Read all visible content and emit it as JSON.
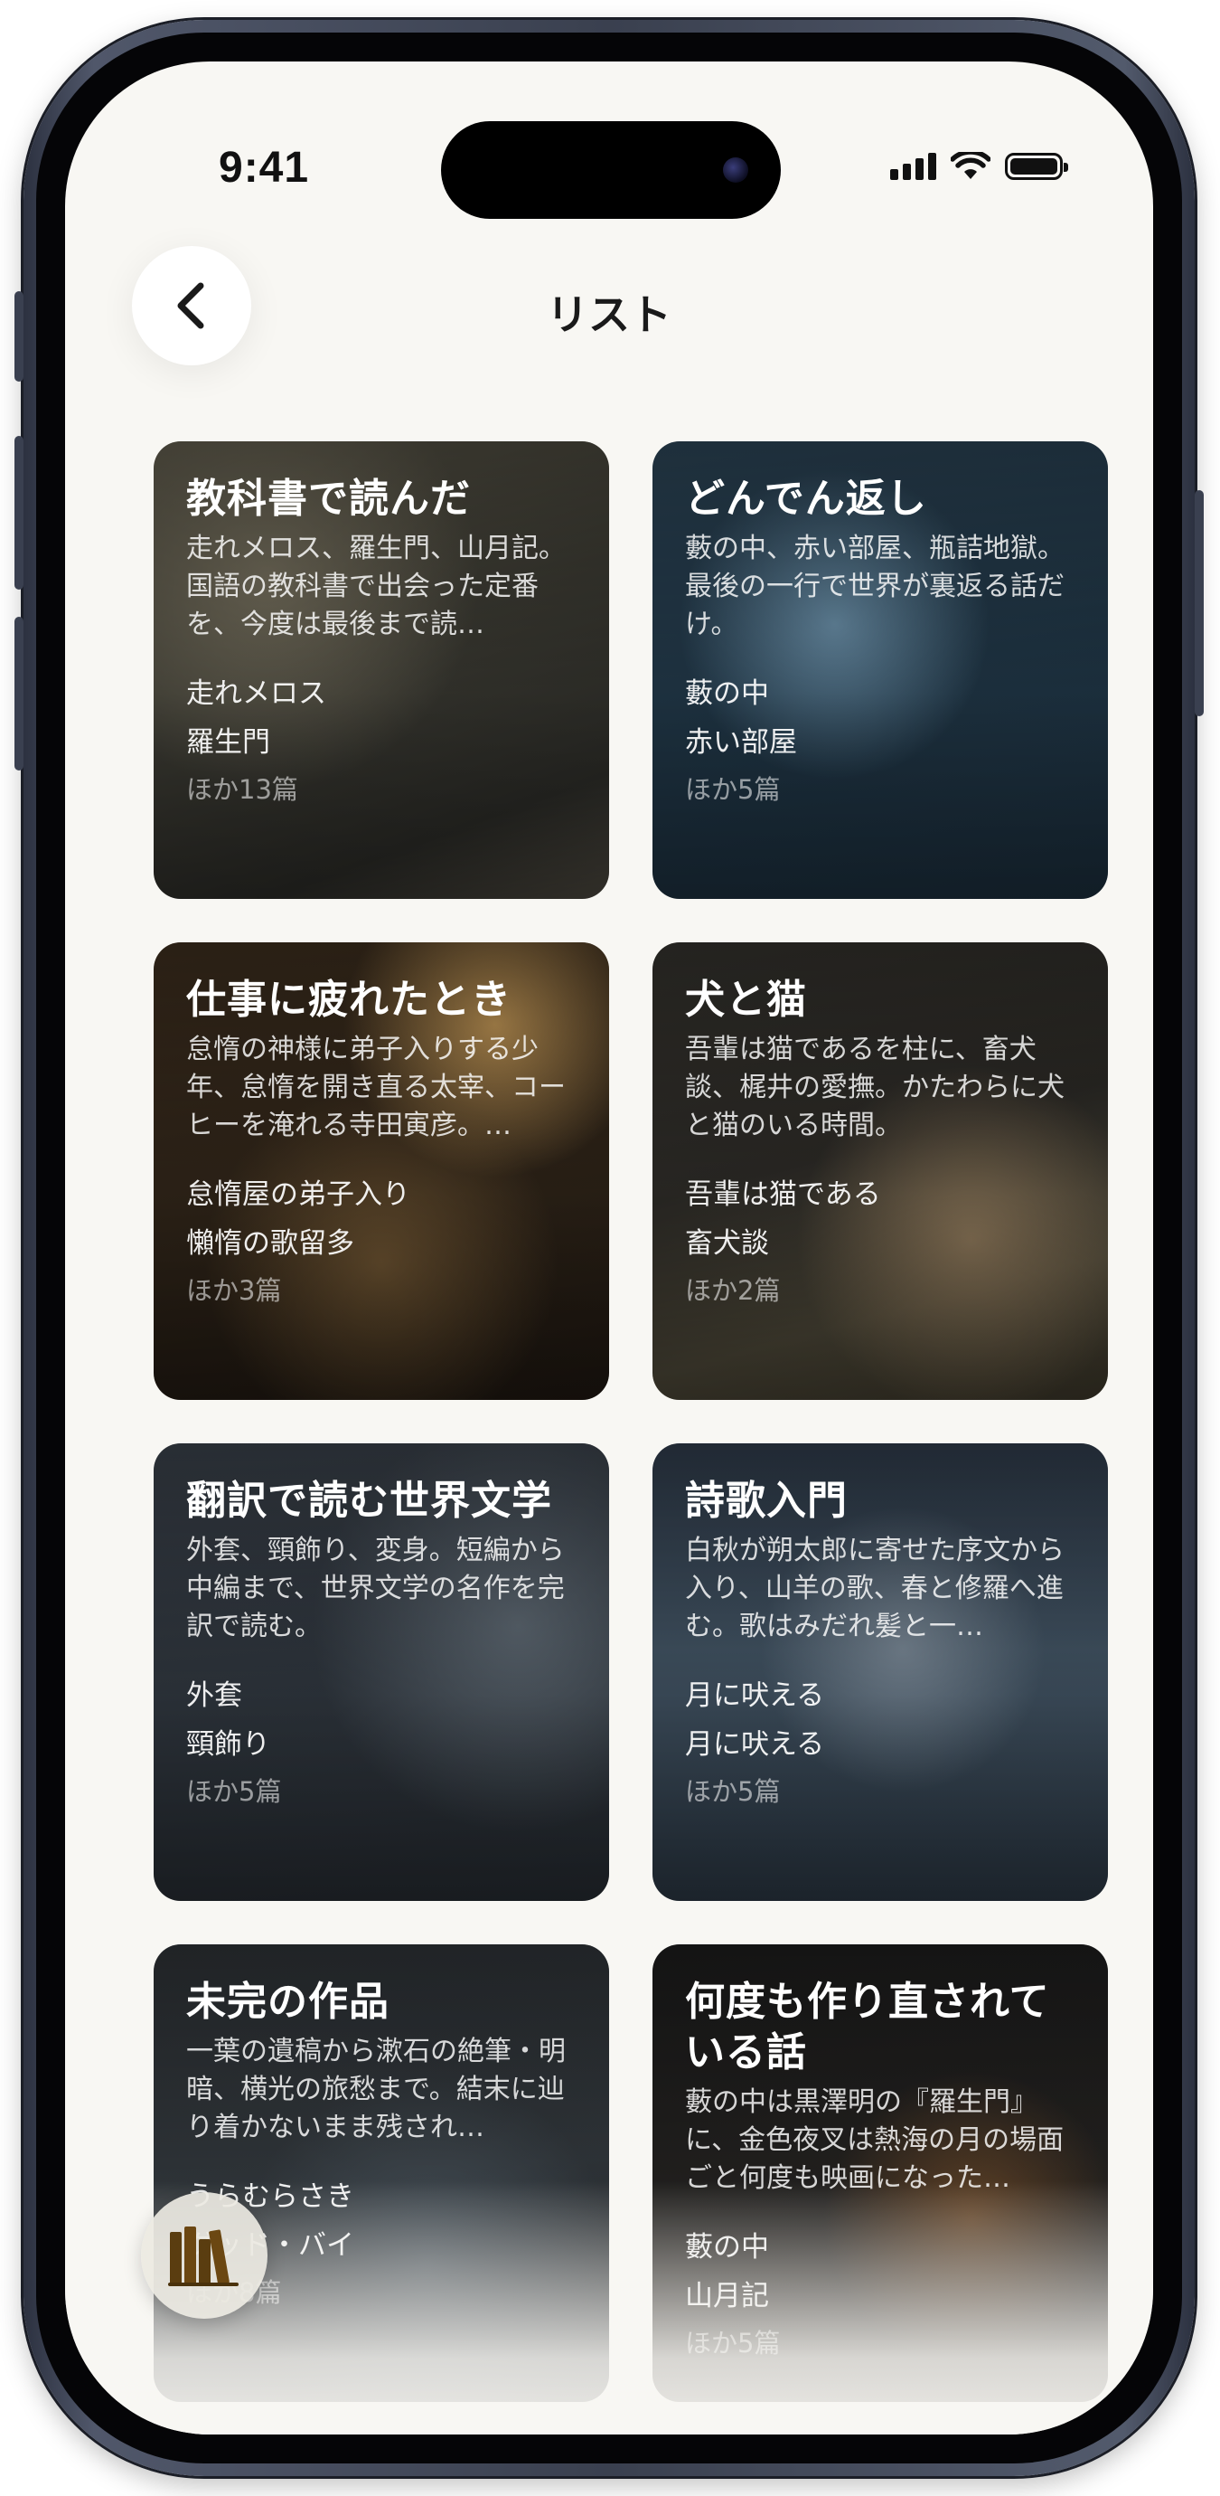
{
  "status_bar": {
    "time": "9:41"
  },
  "nav": {
    "title": "リスト",
    "back_icon": "chevron-left-icon"
  },
  "lists": [
    {
      "title": "教科書で読んだ",
      "description": "走れメロス、羅生門、山月記。国語の教科書で出会った定番を、今度は最後まで読…",
      "items": [
        "走れメロス",
        "羅生門"
      ],
      "more": "ほか13篇"
    },
    {
      "title": "どんでん返し",
      "description": "藪の中、赤い部屋、瓶詰地獄。最後の一行で世界が裏返る話だけ。",
      "items": [
        "藪の中",
        "赤い部屋"
      ],
      "more": "ほか5篇"
    },
    {
      "title": "仕事に疲れたとき",
      "description": "怠惰の神様に弟子入りする少年、怠惰を開き直る太宰、コーヒーを淹れる寺田寅彦。…",
      "items": [
        "怠惰屋の弟子入り",
        "懶惰の歌留多"
      ],
      "more": "ほか3篇"
    },
    {
      "title": "犬と猫",
      "description": "吾輩は猫であるを柱に、畜犬談、梶井の愛撫。かたわらに犬と猫のいる時間。",
      "items": [
        "吾輩は猫である",
        "畜犬談"
      ],
      "more": "ほか2篇"
    },
    {
      "title": "翻訳で読む世界文学",
      "description": "外套、頸飾り、変身。短編から中編まで、世界文学の名作を完訳で読む。",
      "items": [
        "外套",
        "頸飾り"
      ],
      "more": "ほか5篇"
    },
    {
      "title": "詩歌入門",
      "description": "白秋が朔太郎に寄せた序文から入り、山羊の歌、春と修羅へ進む。歌はみだれ髪と一…",
      "items": [
        "月に吠える",
        "月に吠える"
      ],
      "more": "ほか5篇"
    },
    {
      "title": "未完の作品",
      "description": "一葉の遺稿から漱石の絶筆・明暗、横光の旅愁まで。結末に辿り着かないまま残され…",
      "items": [
        "うらむらさき",
        "グッド・バイ"
      ],
      "more": "ほか8篇"
    },
    {
      "title": "何度も作り直されている話",
      "description": "藪の中は黒澤明の『羅生門』に、金色夜叉は熱海の月の場面ごと何度も映画になった…",
      "items": [
        "藪の中",
        "山月記"
      ],
      "more": "ほか5篇"
    }
  ],
  "fab": {
    "icon": "library-books-icon"
  }
}
